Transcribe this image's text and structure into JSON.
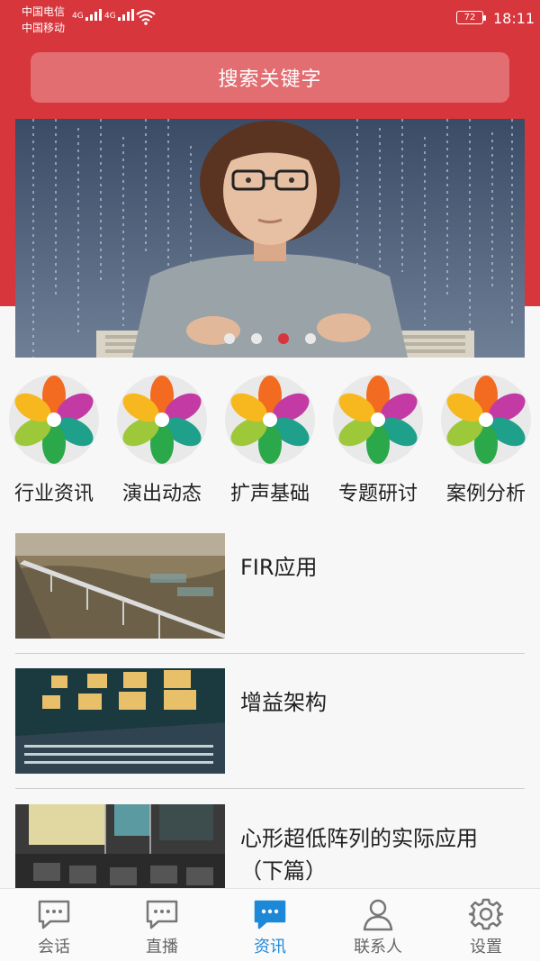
{
  "status": {
    "carrier1": "中国电信",
    "carrier2": "中国移动",
    "network1": "4G",
    "network2": "4G",
    "battery": "72",
    "time": "18:11"
  },
  "search": {
    "placeholder": "搜索关键字"
  },
  "banner": {
    "slide_count": 4,
    "active_index": 2
  },
  "categories": [
    {
      "label": "行业资讯",
      "icon": "colorful-flower-icon"
    },
    {
      "label": "演出动态",
      "icon": "colorful-flower-icon"
    },
    {
      "label": "扩声基础",
      "icon": "colorful-flower-icon"
    },
    {
      "label": "专题研讨",
      "icon": "colorful-flower-icon"
    },
    {
      "label": "案例分析",
      "icon": "colorful-flower-icon"
    }
  ],
  "articles": [
    {
      "title": "FIR应用"
    },
    {
      "title": "增益架构"
    },
    {
      "title": "心形超低阵列的实际应用（下篇）"
    }
  ],
  "nav": {
    "tabs": [
      {
        "label": "会话",
        "icon": "chat-bubble-icon"
      },
      {
        "label": "直播",
        "icon": "chat-bubble-icon"
      },
      {
        "label": "资讯",
        "icon": "chat-bubble-icon"
      },
      {
        "label": "联系人",
        "icon": "person-icon"
      },
      {
        "label": "设置",
        "icon": "gear-icon"
      }
    ],
    "active_index": 2
  },
  "colors": {
    "accent": "#d7363c",
    "nav_active": "#1e88d8"
  }
}
